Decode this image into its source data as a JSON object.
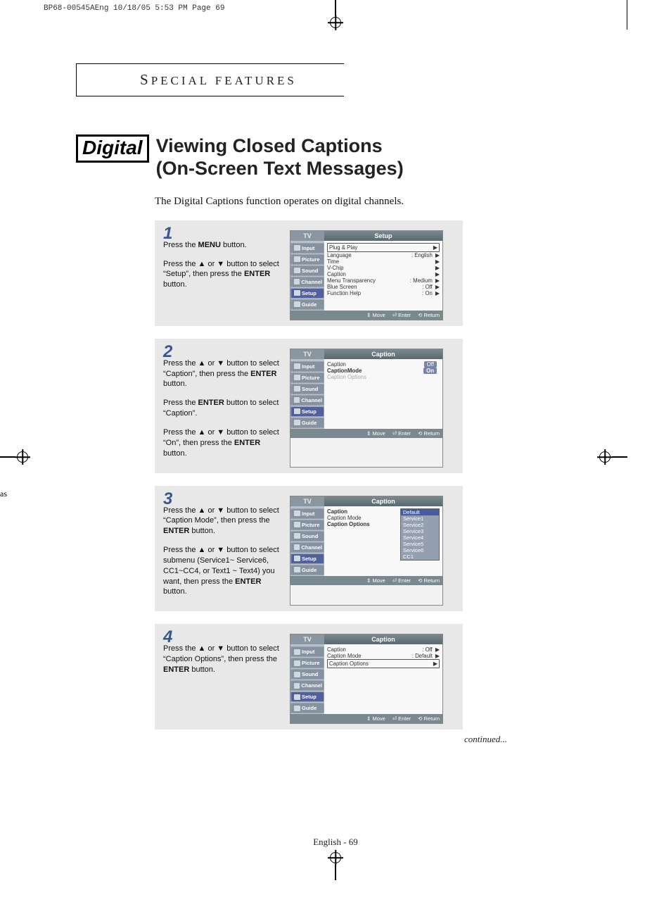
{
  "print_header": "BP68-00545AEng  10/18/05  5:53 PM  Page 69",
  "section_title_1": "S",
  "section_title_rest": "PECIAL  FEATURES",
  "digital_tag": "Digital",
  "main_title_line1": "Viewing Closed Captions",
  "main_title_line2": "(On-Screen Text Messages)",
  "lead_text": "The Digital Captions function operates on digital channels.",
  "sidebar": {
    "tv": "TV",
    "items": [
      "Input",
      "Picture",
      "Sound",
      "Channel",
      "Setup",
      "Guide"
    ]
  },
  "footer": {
    "move": "Move",
    "enter": "Enter",
    "return": "Return"
  },
  "steps": [
    {
      "num": "1",
      "paras": [
        "Press the <b>MENU</b> button.",
        "Press the ▲ or ▼ button to select “Setup”, then press the <b>ENTER</b> button."
      ],
      "osd": {
        "title": "Setup",
        "side_sel": "Setup",
        "rows": [
          {
            "label": "Plug & Play",
            "val": "",
            "arrow": "▶",
            "framed": true
          },
          {
            "label": "Language",
            "val": ": English",
            "arrow": "▶"
          },
          {
            "label": "Time",
            "val": "",
            "arrow": "▶"
          },
          {
            "label": "V-Chip",
            "val": "",
            "arrow": "▶"
          },
          {
            "label": "Caption",
            "val": "",
            "arrow": "▶"
          },
          {
            "label": "Menu Transparency",
            "val": ": Medium",
            "arrow": "▶"
          },
          {
            "label": "Blue Screen",
            "val": ": Off",
            "arrow": "▶"
          },
          {
            "label": "Function Help",
            "val": ": On",
            "arrow": "▶"
          }
        ]
      }
    },
    {
      "num": "2",
      "paras": [
        "Press the ▲ or ▼ button to select “Caption”, then press the <b>ENTER</b> button.",
        "Press the <b>ENTER</b> button to select “Caption”.",
        "Press the ▲ or ▼ button to select “On”, then press the <b>ENTER</b> button."
      ],
      "osd": {
        "title": "Caption",
        "side_sel": "Setup",
        "rows": [
          {
            "label": "Caption",
            "val": "Off",
            "pill": true
          },
          {
            "label": "CaptionMode",
            "val": "On",
            "pill": true,
            "bold": true
          },
          {
            "label": "Caption Options",
            "val": "",
            "arrow": "",
            "grey": true
          }
        ]
      }
    },
    {
      "num": "3",
      "paras": [
        "Press the ▲ or ▼ button to select “Caption Mode”, then press the <b>ENTER</b> button.",
        "Press the ▲ or ▼ button to select  submenu (Service1~ Service6, CC1~CC4, or Text1 ~ Text4) you want, then press the <b>ENTER</b> button."
      ],
      "osd": {
        "title": "Caption",
        "side_sel": "Setup",
        "rows": [
          {
            "label": "Caption",
            "val": ":",
            "bold": true
          },
          {
            "label": "Caption Mode",
            "val": ":"
          },
          {
            "label": "Caption Options",
            "val": "",
            "bold": true
          }
        ],
        "dropdown": [
          "Default",
          "Service1",
          "Service2",
          "Service3",
          "Service4",
          "Service5",
          "Service6",
          "CC1"
        ],
        "dropdown_sel": "Default"
      }
    },
    {
      "num": "4",
      "paras": [
        "Press the ▲ or ▼ button to select “Caption Options”, then press the <b>ENTER</b> button."
      ],
      "osd": {
        "title": "Caption",
        "side_sel": "Setup",
        "rows": [
          {
            "label": "Caption",
            "val": ": Off",
            "arrow": "▶"
          },
          {
            "label": "Caption Mode",
            "val": ": Default",
            "arrow": "▶"
          },
          {
            "label": "Caption Options",
            "val": "",
            "arrow": "▶",
            "framed": true
          }
        ]
      }
    }
  ],
  "continued": "continued...",
  "side_as": "as",
  "page_num": "English - 69"
}
